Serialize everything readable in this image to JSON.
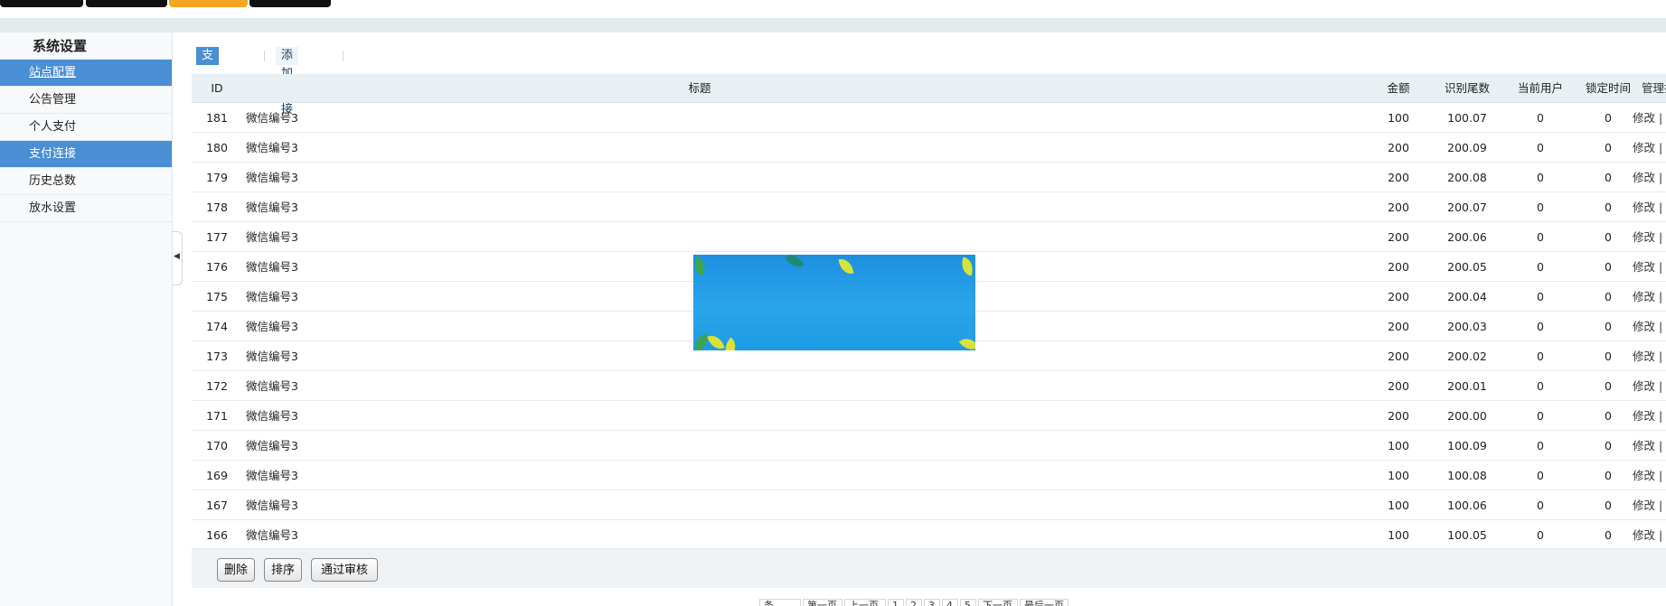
{
  "sidebar": {
    "title": "系统设置",
    "items": [
      {
        "label": "站点配置"
      },
      {
        "label": "公告管理"
      },
      {
        "label": "个人支付"
      },
      {
        "label": "支付连接"
      },
      {
        "label": "历史总数"
      },
      {
        "label": "放水设置"
      }
    ]
  },
  "subtabs": {
    "active": "支付连接",
    "add": "添加连接"
  },
  "table": {
    "headers": {
      "id": "ID",
      "title": "标题",
      "amount": "金额",
      "code": "识别尾数",
      "user": "当前用户",
      "lock": "锁定时间",
      "manage": "管理操作"
    },
    "rows": [
      {
        "id": "181",
        "title": "微信编号3",
        "amount": "100",
        "code": "100.07",
        "user": "0",
        "lock": "0",
        "manage": "修改 | 删"
      },
      {
        "id": "180",
        "title": "微信编号3",
        "amount": "200",
        "code": "200.09",
        "user": "0",
        "lock": "0",
        "manage": "修改 | 删"
      },
      {
        "id": "179",
        "title": "微信编号3",
        "amount": "200",
        "code": "200.08",
        "user": "0",
        "lock": "0",
        "manage": "修改 | 删"
      },
      {
        "id": "178",
        "title": "微信编号3",
        "amount": "200",
        "code": "200.07",
        "user": "0",
        "lock": "0",
        "manage": "修改 | 删"
      },
      {
        "id": "177",
        "title": "微信编号3",
        "amount": "200",
        "code": "200.06",
        "user": "0",
        "lock": "0",
        "manage": "修改 | 删"
      },
      {
        "id": "176",
        "title": "微信编号3",
        "amount": "200",
        "code": "200.05",
        "user": "0",
        "lock": "0",
        "manage": "修改 | 删"
      },
      {
        "id": "175",
        "title": "微信编号3",
        "amount": "200",
        "code": "200.04",
        "user": "0",
        "lock": "0",
        "manage": "修改 | 删"
      },
      {
        "id": "174",
        "title": "微信编号3",
        "amount": "200",
        "code": "200.03",
        "user": "0",
        "lock": "0",
        "manage": "修改 | 删"
      },
      {
        "id": "173",
        "title": "微信编号3",
        "amount": "200",
        "code": "200.02",
        "user": "0",
        "lock": "0",
        "manage": "修改 | 删"
      },
      {
        "id": "172",
        "title": "微信编号3",
        "amount": "200",
        "code": "200.01",
        "user": "0",
        "lock": "0",
        "manage": "修改 | 删"
      },
      {
        "id": "171",
        "title": "微信编号3",
        "amount": "200",
        "code": "200.00",
        "user": "0",
        "lock": "0",
        "manage": "修改 | 删"
      },
      {
        "id": "170",
        "title": "微信编号3",
        "amount": "100",
        "code": "100.09",
        "user": "0",
        "lock": "0",
        "manage": "修改 | 删"
      },
      {
        "id": "169",
        "title": "微信编号3",
        "amount": "100",
        "code": "100.08",
        "user": "0",
        "lock": "0",
        "manage": "修改 | 删"
      },
      {
        "id": "167",
        "title": "微信编号3",
        "amount": "100",
        "code": "100.06",
        "user": "0",
        "lock": "0",
        "manage": "修改 | 删"
      },
      {
        "id": "166",
        "title": "微信编号3",
        "amount": "100",
        "code": "100.05",
        "user": "0",
        "lock": "0",
        "manage": "修改 | 删"
      }
    ]
  },
  "actions": {
    "delete": "删除",
    "sort": "排序",
    "approve": "通过审核"
  },
  "pager": {
    "items": [
      "条",
      "第一页",
      "上一页",
      "1",
      "2",
      "3",
      "4",
      "5",
      "下一页",
      "最后一页"
    ]
  },
  "colors": {
    "accent": "#4a8ed3",
    "top_tab_active": "#f5a623",
    "top_tab": "#111111"
  },
  "icons": {
    "collapse": "caret-left-icon"
  }
}
